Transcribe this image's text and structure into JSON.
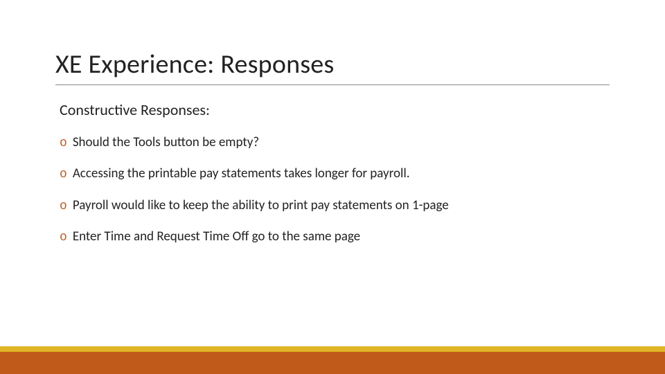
{
  "slide": {
    "title": "XE Experience: Responses",
    "subheading": "Constructive Responses:",
    "bullets": [
      "Should the Tools button be empty?",
      "Accessing the printable pay statements takes longer for payroll.",
      "Payroll would like to keep the ability to print pay statements on 1-page",
      "Enter Time and Request Time Off go to the same page"
    ],
    "bullet_marker": "o"
  },
  "colors": {
    "accent_orange": "#c05a1a",
    "accent_gold": "#e0b424"
  }
}
